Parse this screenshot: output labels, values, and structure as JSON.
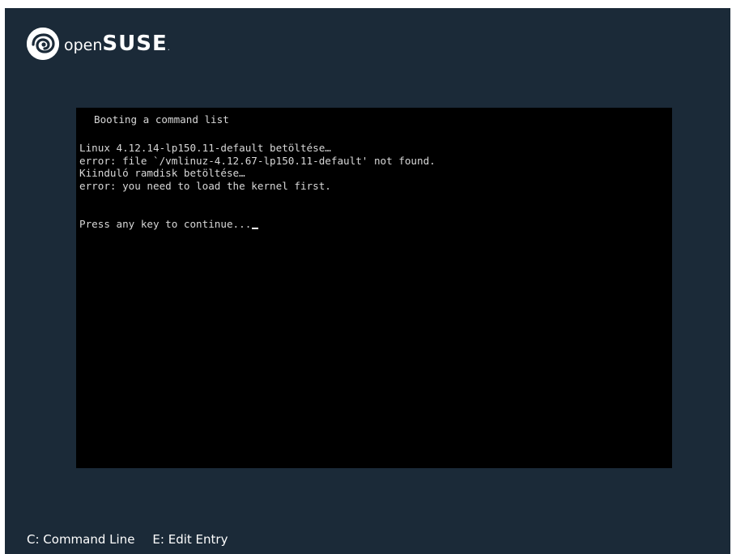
{
  "branding": {
    "logo_icon": "opensuse-chameleon-icon",
    "name_light": "open",
    "name_bold": "SUSE",
    "name_dot": "."
  },
  "terminal": {
    "heading": "Booting a command list",
    "lines": [
      "Linux 4.12.14-lp150.11-default betöltése…",
      "error: file `/vmlinuz-4.12.67-lp150.11-default' not found.",
      "Kiinduló ramdisk betöltése…",
      "error: you need to load the kernel first."
    ],
    "prompt": "Press any key to continue..."
  },
  "footer": {
    "command_line_hint": "C: Command Line",
    "edit_entry_hint": "E: Edit Entry"
  },
  "colors": {
    "background": "#1b2a38",
    "terminal_bg": "#000000",
    "text": "#d8d8d8"
  }
}
